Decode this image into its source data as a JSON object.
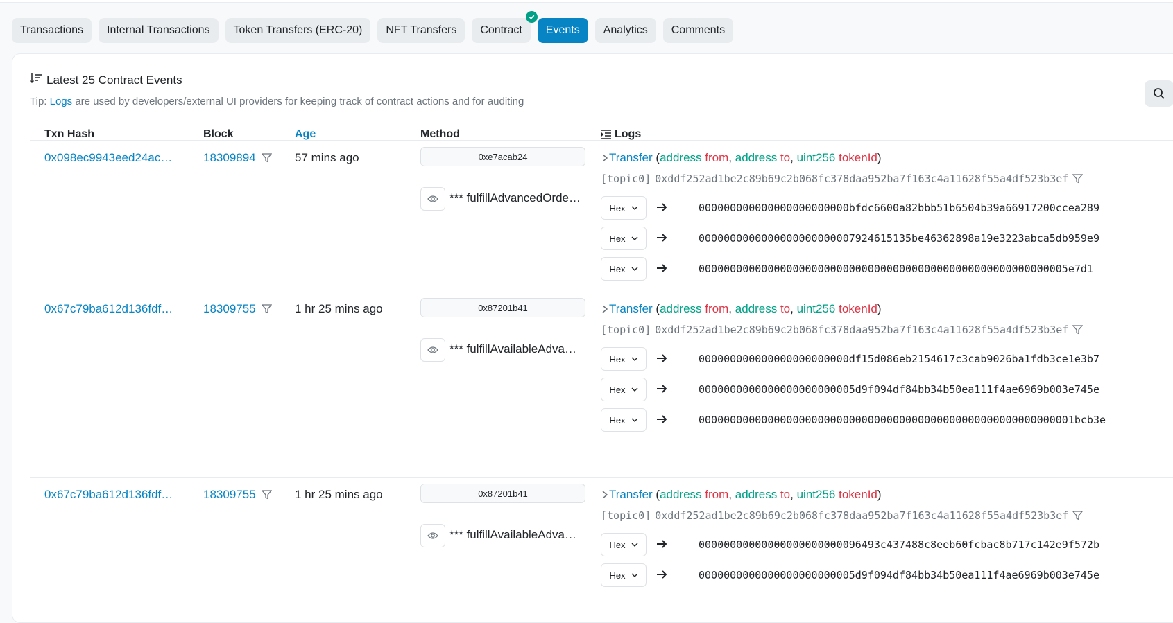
{
  "tabs": [
    {
      "label": "Transactions"
    },
    {
      "label": "Internal Transactions"
    },
    {
      "label": "Token Transfers (ERC-20)"
    },
    {
      "label": "NFT Transfers"
    },
    {
      "label": "Contract"
    },
    {
      "label": "Events"
    },
    {
      "label": "Analytics"
    },
    {
      "label": "Comments"
    }
  ],
  "active_tab": "Events",
  "card": {
    "title": "Latest 25 Contract Events",
    "tip_prefix": "Tip: ",
    "tip_link": "Logs",
    "tip_rest": " are used by developers/external UI providers for keeping track of contract actions and for auditing"
  },
  "table": {
    "headers": {
      "txn": "Txn Hash",
      "block": "Block",
      "age": "Age",
      "method": "Method",
      "logs": "Logs"
    },
    "rows": [
      {
        "txn": "0x098ec9943eed24ac…",
        "block": "18309894",
        "age": "57 mins ago",
        "method_id": "0xe7acab24",
        "function": "*** fulfillAdvancedOrde…",
        "event": "Transfer",
        "sig": {
          "t1": "address",
          "n1": "from",
          "t2": "address",
          "n2": "to",
          "t3": "uint256",
          "n3": "tokenId"
        },
        "topic_label": "[topic0]",
        "topic": "0xddf252ad1be2c89b69c2b068fc378daa952ba7f163c4a11628f55a4df523b3ef",
        "hex_label": "Hex",
        "values": [
          "000000000000000000000000bfdc6600a82bbb51b6504b39a66917200ccea289",
          "0000000000000000000000007924615135be46362898a19e3223abca5db959e9",
          "00000000000000000000000000000000000000000000000000000000005e7d1"
        ]
      },
      {
        "txn": "0x67c79ba612d136fdf…",
        "block": "18309755",
        "age": "1 hr 25 mins ago",
        "method_id": "0x87201b41",
        "function": "*** fulfillAvailableAdva…",
        "event": "Transfer",
        "sig": {
          "t1": "address",
          "n1": "from",
          "t2": "address",
          "n2": "to",
          "t3": "uint256",
          "n3": "tokenId"
        },
        "topic_label": "[topic0]",
        "topic": "0xddf252ad1be2c89b69c2b068fc378daa952ba7f163c4a11628f55a4df523b3ef",
        "hex_label": "Hex",
        "values": [
          "000000000000000000000000df15d086eb2154617c3cab9026ba1fdb3ce1e3b7",
          "0000000000000000000000005d9f094df84bb34b50ea111f4ae6969b003e745e",
          "000000000000000000000000000000000000000000000000000000000001bcb3e"
        ]
      },
      {
        "txn": "0x67c79ba612d136fdf…",
        "block": "18309755",
        "age": "1 hr 25 mins ago",
        "method_id": "0x87201b41",
        "function": "*** fulfillAvailableAdva…",
        "event": "Transfer",
        "sig": {
          "t1": "address",
          "n1": "from",
          "t2": "address",
          "n2": "to",
          "t3": "uint256",
          "n3": "tokenId"
        },
        "topic_label": "[topic0]",
        "topic": "0xddf252ad1be2c89b69c2b068fc378daa952ba7f163c4a11628f55a4df523b3ef",
        "hex_label": "Hex",
        "values": [
          "00000000000000000000000096493c437488c8eeb60fcbac8b717c142e9f572b",
          "0000000000000000000000005d9f094df84bb34b50ea111f4ae6969b003e745e"
        ]
      }
    ]
  },
  "colors": {
    "accent": "#0784c3",
    "type": "#00a186",
    "param": "#dc3545"
  }
}
